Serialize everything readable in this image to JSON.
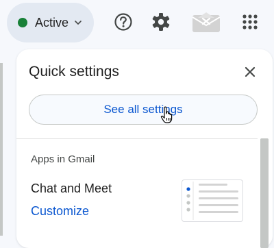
{
  "header": {
    "status": {
      "label": "Active",
      "color": "#188038",
      "icon": "chevron-down-icon"
    },
    "icons": [
      "help-icon",
      "settings-gear-icon",
      "envelope-icon",
      "apps-grid-icon"
    ]
  },
  "quick_settings": {
    "title": "Quick settings",
    "close_icon": "close-icon",
    "see_all_label": "See all settings",
    "section_label": "Apps in Gmail",
    "chat_meet_label": "Chat and Meet",
    "customize_label": "Customize"
  },
  "colors": {
    "accent": "#0b57d0",
    "background": "#f6f8fc",
    "chip": "#e3e9f2",
    "panel": "#ffffff"
  }
}
